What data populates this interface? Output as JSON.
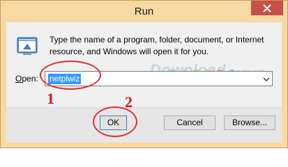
{
  "window": {
    "title": "Run"
  },
  "dialog": {
    "description": "Type the name of a program, folder, document, or Internet resource, and Windows will open it for you.",
    "open_label_underlined": "O",
    "open_label_rest": "pen:",
    "open_value": "netplwiz"
  },
  "buttons": {
    "ok": "OK",
    "cancel": "Cancel",
    "browse": "Browse..."
  },
  "annotations": {
    "step1": "1",
    "step2": "2",
    "color": "#e03030"
  },
  "watermark": {
    "text": "Download",
    "suffix": ".com.vn"
  },
  "colors": {
    "title_bar": "#f7d9a3",
    "close_button": "#c7504a",
    "selection": "#3399ff",
    "watermark_dots": [
      "#6ec3f0",
      "#a9d6f5",
      "#a6d46a",
      "#f6b94a",
      "#ef7e7e",
      "#7fb3e8"
    ]
  },
  "icons": {
    "close": "close-icon",
    "run": "run-icon",
    "dropdown": "chevron-down-icon"
  }
}
